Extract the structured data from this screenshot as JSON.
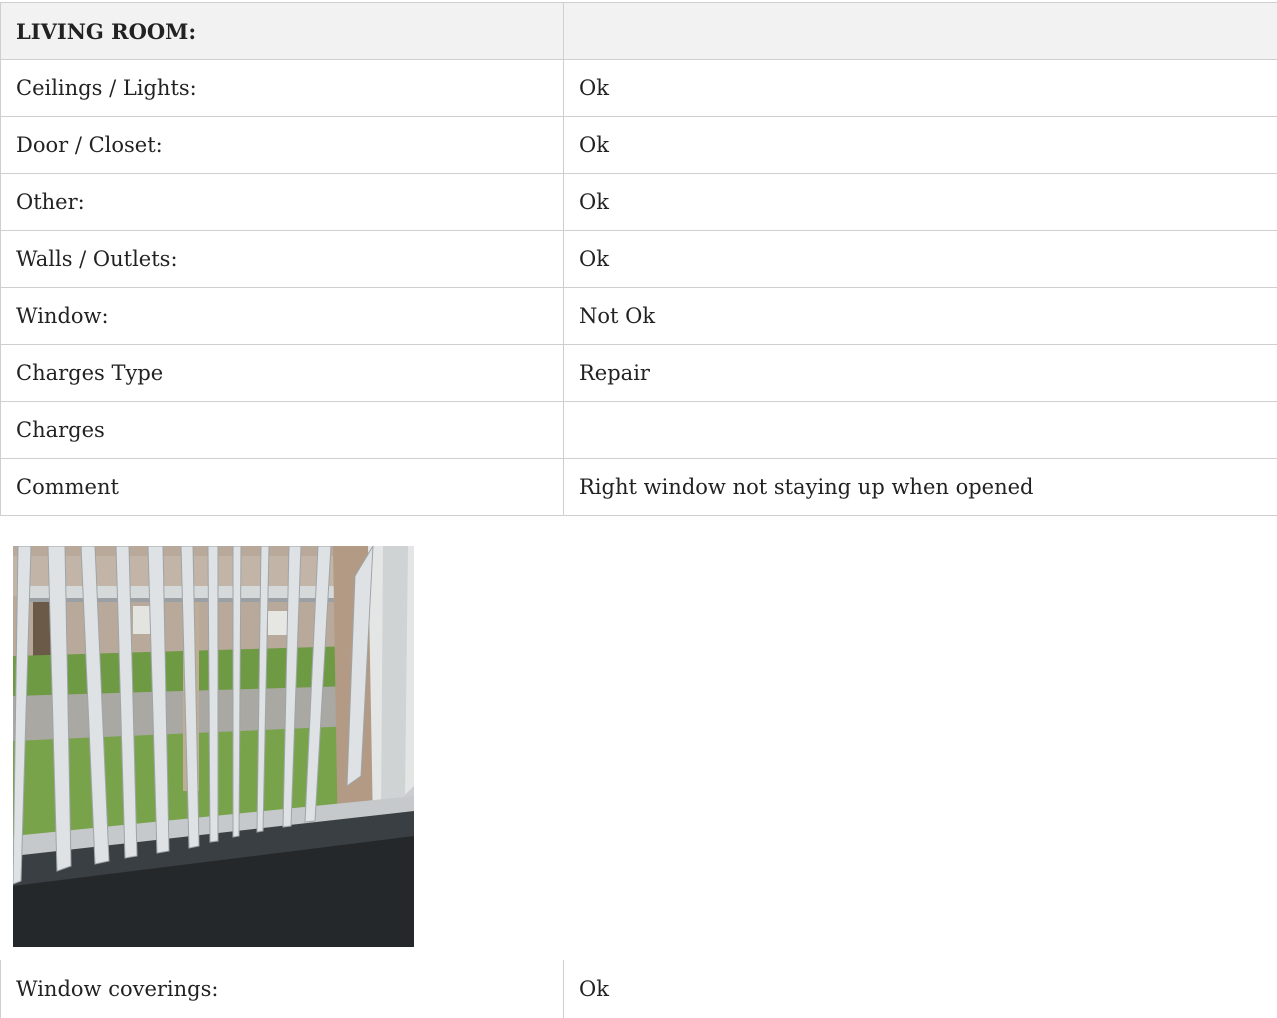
{
  "section": {
    "title": "LIVING ROOM:",
    "value": ""
  },
  "rows": [
    {
      "label": "Ceilings / Lights:",
      "value": "Ok"
    },
    {
      "label": "Door / Closet:",
      "value": "Ok"
    },
    {
      "label": "Other:",
      "value": "Ok"
    },
    {
      "label": "Walls / Outlets:",
      "value": "Ok"
    },
    {
      "label": "Window:",
      "value": "Not Ok"
    },
    {
      "label": "Charges Type",
      "value": "Repair"
    },
    {
      "label": "Charges",
      "value": ""
    },
    {
      "label": "Comment",
      "value": "Right window not staying up when opened"
    }
  ],
  "after_photo": [
    {
      "label": "Window coverings:",
      "value": "Ok"
    }
  ]
}
